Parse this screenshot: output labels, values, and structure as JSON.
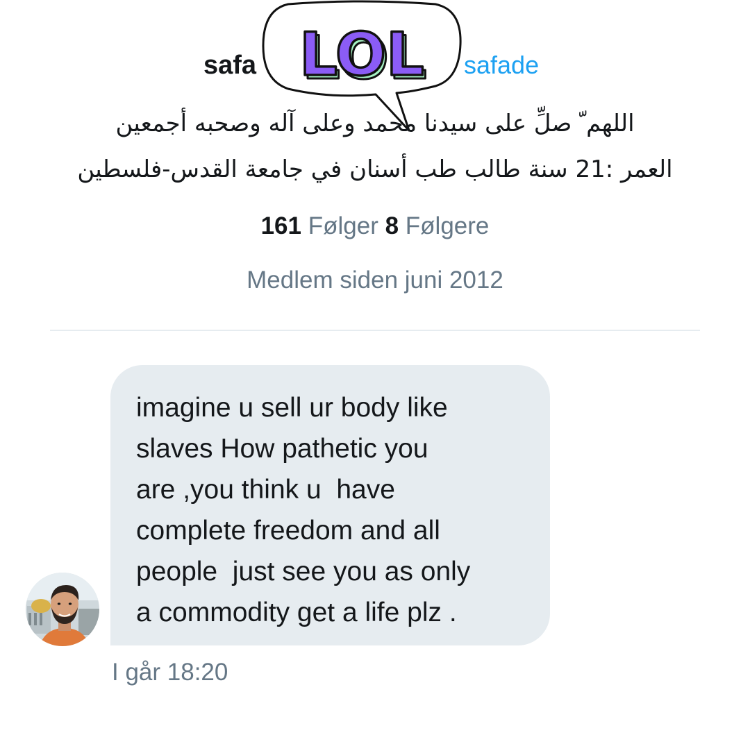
{
  "profile": {
    "display_name": "safa",
    "handle": "safade",
    "bio_lines": [
      "اللهم ّ صلِّ على سيدنا محمد وعلى آله وصحبه أجمعين",
      "العمر :21 سنة طالب طب أسنان في جامعة القدس-فلسطين"
    ],
    "following_count": "161",
    "following_label": "Følger",
    "followers_count": "8",
    "followers_label": "Følgere",
    "joined": "Medlem siden juni 2012"
  },
  "sticker": {
    "text": "LOL",
    "fill_color": "#8b5cf6",
    "shadow_color": "#a7f3c4",
    "icon": "speech-bubble-icon"
  },
  "message": {
    "lines": [
      "imagine u sell ur body like",
      "slaves How pathetic you",
      "are ,you think u  have",
      "complete freedom and all",
      "people  just see you as only",
      "a commodity get a life plz ."
    ],
    "timestamp": "I går 18:20",
    "avatar_icon": "user-avatar"
  },
  "colors": {
    "text": "#14171a",
    "muted": "#657786",
    "accent": "#1da1f2",
    "bubble": "#e6ecf0"
  }
}
